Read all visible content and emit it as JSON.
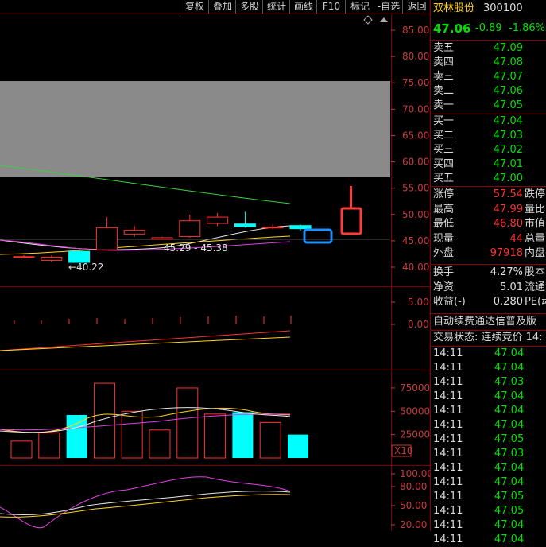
{
  "toolbar": {
    "fuquan": "复权",
    "diejia": "叠加",
    "duogu": "多股",
    "tongji": "统计",
    "huaxian": "画线",
    "f10": "F10",
    "biaoji": "标记",
    "zixuan": "-自选",
    "fanhui": "返回"
  },
  "stock": {
    "name": "双林股份",
    "code": "300100",
    "price": "47.06",
    "change": "-0.89",
    "change_pct": "-1.86%"
  },
  "colors": {
    "up": "#ff3232",
    "down": "#00ffff",
    "price_green": "#00e000",
    "axis_red": "#c83a3a",
    "grid": "#7a0000",
    "yellow": "#ffd21e"
  },
  "sell_orders": [
    {
      "label": "卖五",
      "price": "47.09"
    },
    {
      "label": "卖四",
      "price": "47.08"
    },
    {
      "label": "卖三",
      "price": "47.07"
    },
    {
      "label": "卖二",
      "price": "47.06"
    },
    {
      "label": "卖一",
      "price": "47.05"
    }
  ],
  "buy_orders": [
    {
      "label": "买一",
      "price": "47.04"
    },
    {
      "label": "买二",
      "price": "47.03"
    },
    {
      "label": "买三",
      "price": "47.02"
    },
    {
      "label": "买四",
      "price": "47.01"
    },
    {
      "label": "买五",
      "price": "47.00"
    }
  ],
  "stats": [
    {
      "label": "涨停",
      "value": "57.54",
      "ext": "跌停"
    },
    {
      "label": "最高",
      "value": "47.99",
      "ext": "量比"
    },
    {
      "label": "最低",
      "value": "46.80",
      "ext": "市值"
    },
    {
      "label": "现量",
      "value": "44",
      "ext": "总量"
    },
    {
      "label": "外盘",
      "value": "97918",
      "ext": "内盘"
    }
  ],
  "fundamentals": [
    {
      "label": "换手",
      "value": "4.27%",
      "ext": "股本"
    },
    {
      "label": "净资",
      "value": "5.01",
      "ext": "流通"
    },
    {
      "label": "收益(-)",
      "value": "0.280",
      "ext": "PE(动"
    }
  ],
  "notice": "自动续费通达信普及版",
  "trade_status": "交易状态: 连续竞价 14:",
  "ticks": [
    {
      "time": "14:11",
      "price": "47.04"
    },
    {
      "time": "14:11",
      "price": "47.04"
    },
    {
      "time": "14:11",
      "price": "47.03"
    },
    {
      "time": "14:11",
      "price": "47.04"
    },
    {
      "time": "14:11",
      "price": "47.04"
    },
    {
      "time": "14:11",
      "price": "47.04"
    },
    {
      "time": "14:11",
      "price": "47.05"
    },
    {
      "time": "14:11",
      "price": "47.03"
    },
    {
      "time": "14:11",
      "price": "47.04"
    },
    {
      "time": "14:11",
      "price": "47.04"
    },
    {
      "time": "14:11",
      "price": "47.05"
    },
    {
      "time": "14:11",
      "price": "47.05"
    },
    {
      "time": "14:11",
      "price": "47.04"
    },
    {
      "time": "14:11",
      "price": "47.04"
    }
  ],
  "chart_data": {
    "type": "candlestick",
    "price_axis": [
      "85.00",
      "80.00",
      "75.00",
      "70.00",
      "65.00",
      "60.00",
      "55.00",
      "50.00",
      "45.00",
      "40.00"
    ],
    "price_ylim": [
      38.5,
      87
    ],
    "candles": [
      {
        "open": 42.0,
        "close": 42.0,
        "high": 42.3,
        "low": 41.7
      },
      {
        "open": 41.3,
        "close": 41.9,
        "high": 42.2,
        "low": 41.0
      },
      {
        "open": 43.0,
        "close": 40.9,
        "high": 43.4,
        "low": 40.2
      },
      {
        "open": 43.3,
        "close": 47.5,
        "high": 49.5,
        "low": 43.1
      },
      {
        "open": 46.3,
        "close": 47.0,
        "high": 47.8,
        "low": 45.8
      },
      {
        "open": 45.3,
        "close": 45.6,
        "high": 45.8,
        "low": 45.2
      },
      {
        "open": 45.8,
        "close": 48.8,
        "high": 50.0,
        "low": 45.6
      },
      {
        "open": 48.3,
        "close": 49.5,
        "high": 50.3,
        "low": 47.8
      },
      {
        "open": 48.2,
        "close": 47.7,
        "high": 50.5,
        "low": 47.5
      },
      {
        "open": 47.6,
        "close": 47.6,
        "high": 48.2,
        "low": 47.2
      },
      {
        "open": 47.9,
        "close": 47.3,
        "high": 48.1,
        "low": 46.9
      }
    ],
    "low_label": "←40.22",
    "range_label": "45.29 - 45.38",
    "vol_axis": [
      "75000",
      "50000",
      "25000"
    ],
    "vol_ylim": [
      0,
      92000
    ],
    "volumes": [
      18000,
      27000,
      46000,
      80000,
      50000,
      30000,
      75000,
      47000,
      49000,
      38000,
      25000
    ],
    "vol_unit": "X10",
    "macd_axis": [
      "5.00",
      "0.00"
    ],
    "kdj_axis": [
      "100.00",
      "80.00",
      "50.00",
      "20.00"
    ]
  }
}
